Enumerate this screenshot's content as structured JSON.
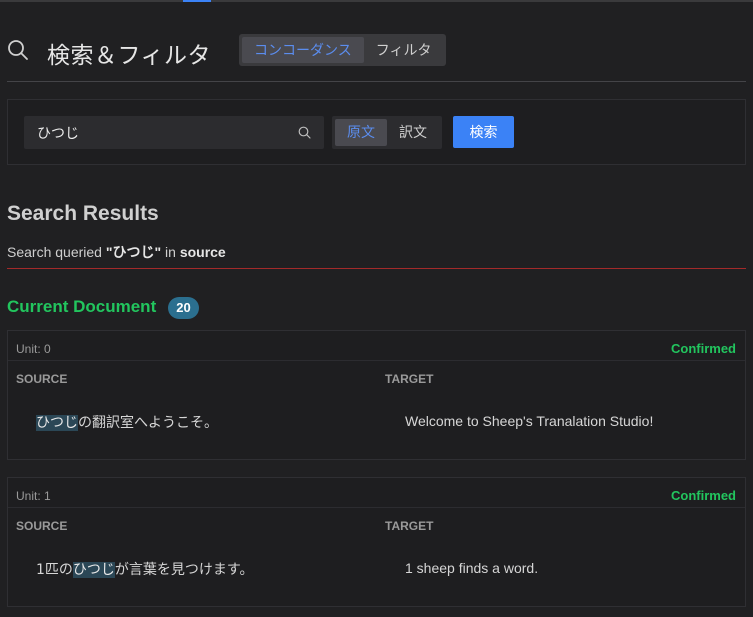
{
  "header": {
    "title": "検索＆フィルタ",
    "tabs": [
      {
        "label": "コンコーダンス",
        "active": true
      },
      {
        "label": "フィルタ",
        "active": false
      }
    ]
  },
  "search": {
    "value": "ひつじ",
    "scopes": [
      {
        "label": "原文",
        "active": true
      },
      {
        "label": "訳文",
        "active": false
      }
    ],
    "button_label": "検索"
  },
  "results": {
    "title": "Search Results",
    "query_prefix": "Search queried",
    "query_term": "\"ひつじ\"",
    "query_mid": "in",
    "query_scope": "source"
  },
  "section": {
    "title": "Current Document",
    "count": "20"
  },
  "columns": {
    "source": "SOURCE",
    "target": "TARGET"
  },
  "units": [
    {
      "id_label": "Unit: 0",
      "status": "Confirmed",
      "source_before": "",
      "source_match": "ひつじ",
      "source_after": "の翻訳室へようこそ。",
      "target": "Welcome to Sheep's Tranalation Studio!"
    },
    {
      "id_label": "Unit: 1",
      "status": "Confirmed",
      "source_before": "1匹の",
      "source_match": "ひつじ",
      "source_after": "が言葉を見つけます。",
      "target": "1 sheep finds a word."
    }
  ],
  "colors": {
    "accent": "#3b82f6",
    "success": "#22c55e",
    "badge": "#2b6f8f",
    "divider_error": "#a32a2a"
  }
}
